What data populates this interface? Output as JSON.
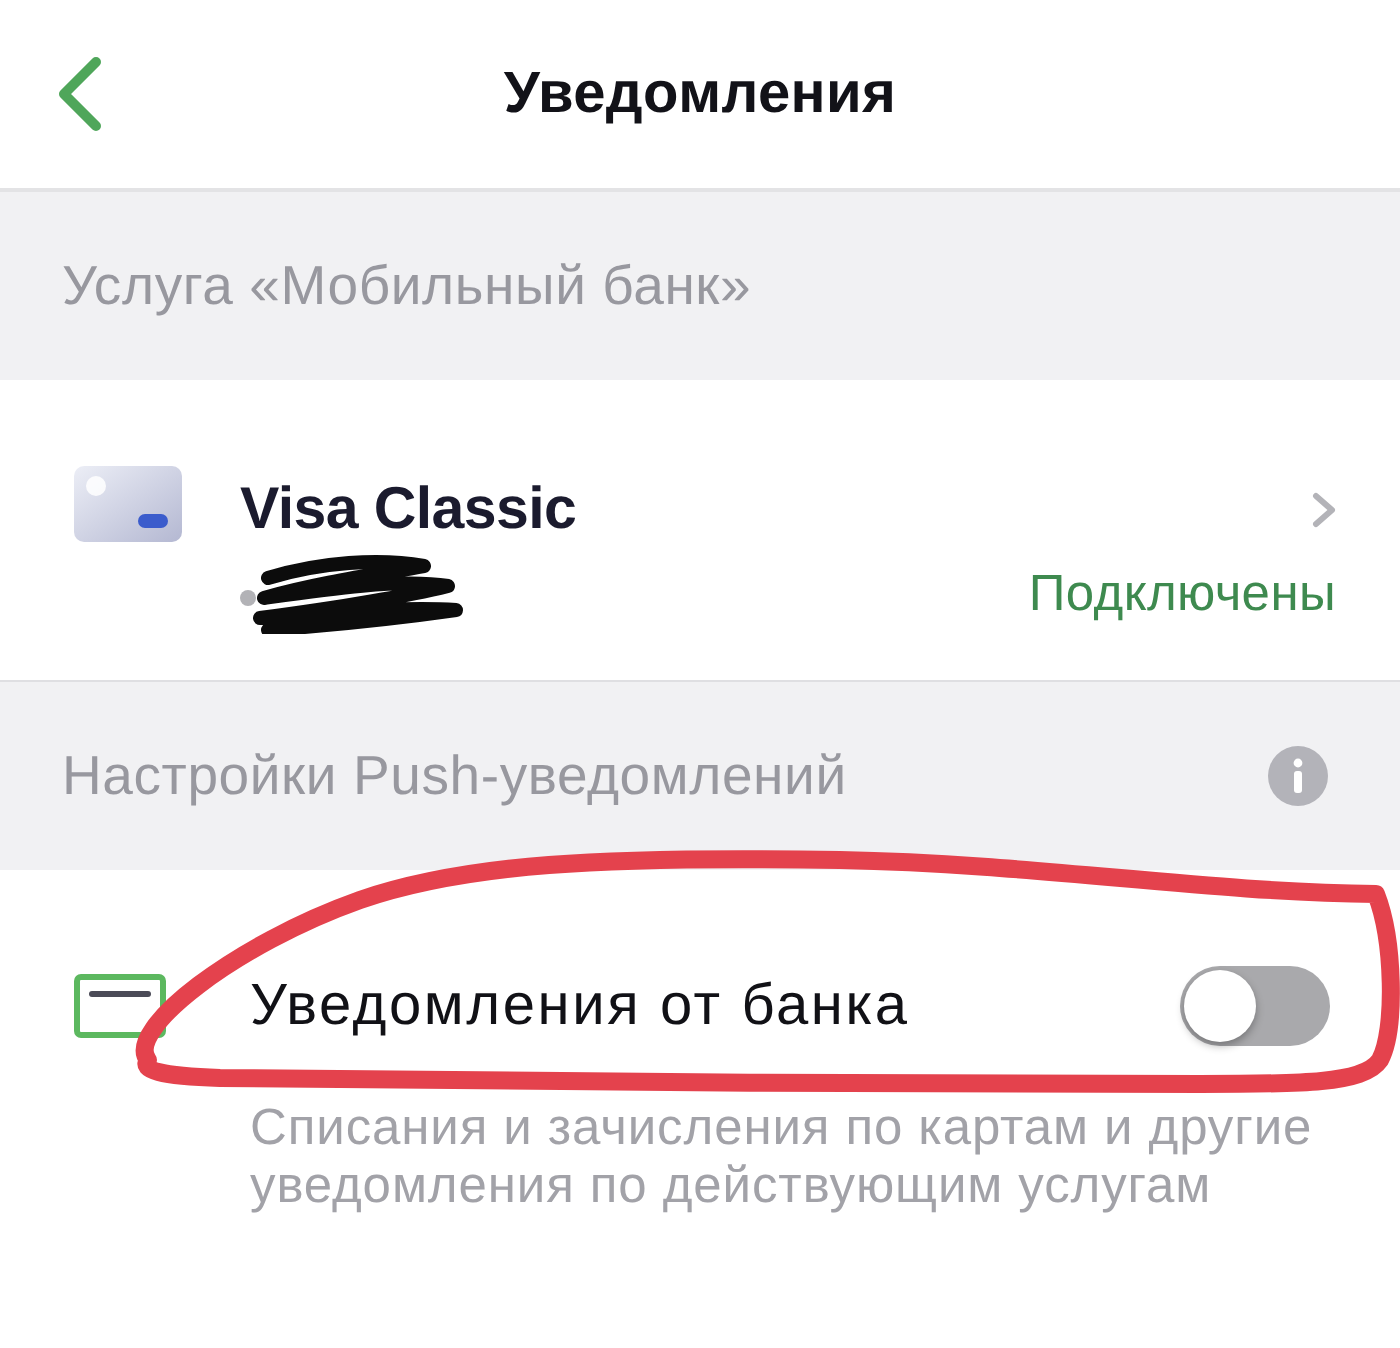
{
  "header": {
    "title": "Уведомления"
  },
  "sections": [
    {
      "title": "Услуга «Мобильный банк»",
      "info": false,
      "rows": [
        {
          "kind": "card",
          "title": "Visa Classic",
          "status": "Подключены"
        }
      ]
    },
    {
      "title": "Настройки Push-уведомлений",
      "info": true,
      "rows": [
        {
          "kind": "toggle",
          "title": "Уведомления от банка",
          "on": false,
          "description": "Списания и зачисления по картам и другие уведомления по действующим услугам"
        }
      ]
    }
  ]
}
